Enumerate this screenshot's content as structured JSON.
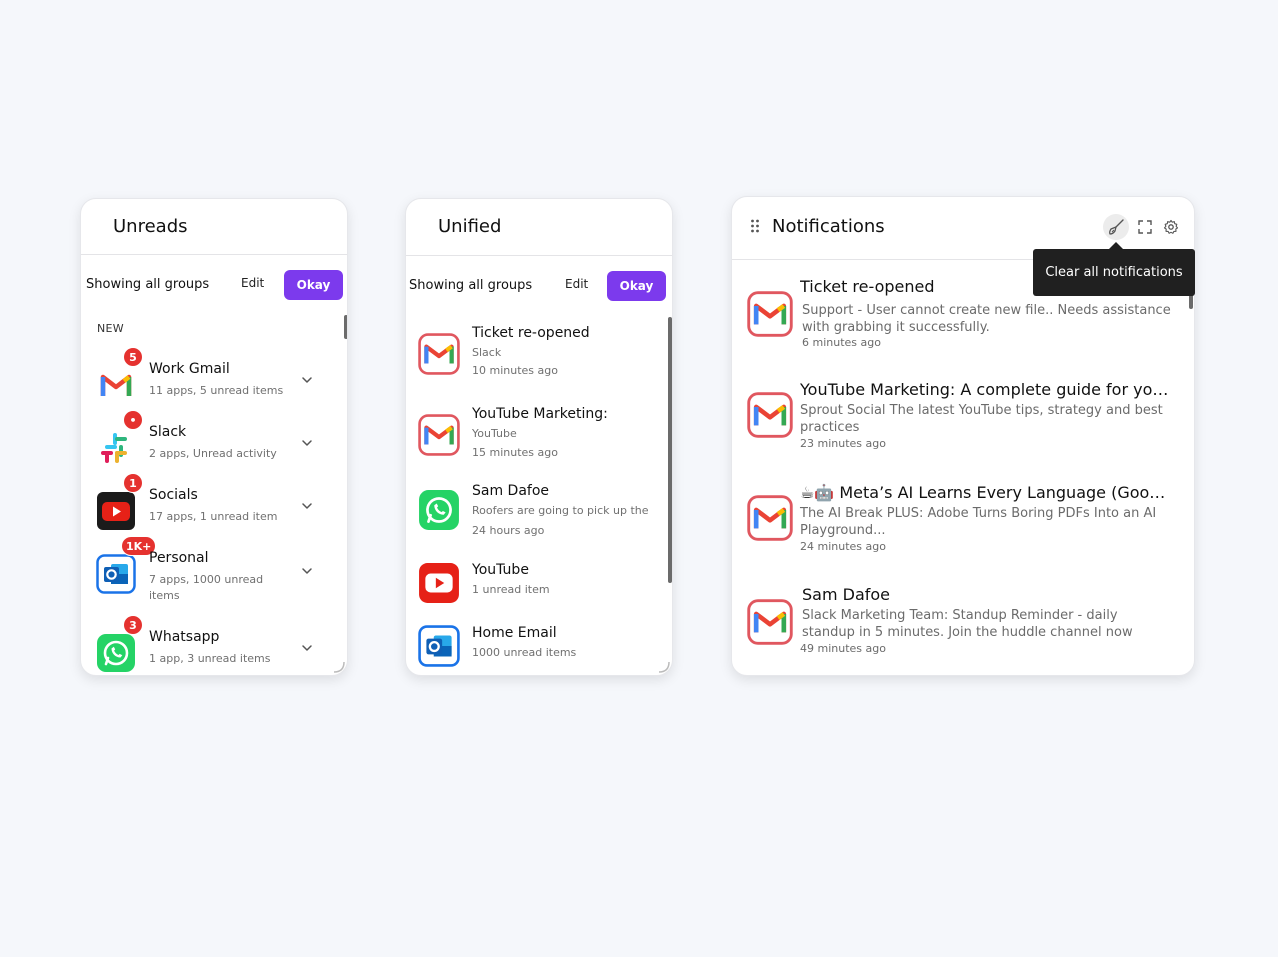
{
  "unreads": {
    "title": "Unreads",
    "showing": "Showing all groups",
    "edit_label": "Edit",
    "okay_label": "Okay",
    "section": "NEW",
    "groups": [
      {
        "name": "Work Gmail",
        "sub": "11 apps, 5 unread items",
        "badge": "5",
        "icon": "gmail-icon"
      },
      {
        "name": "Slack",
        "sub": "2 apps, Unread activity",
        "badge": "•",
        "icon": "slack-icon"
      },
      {
        "name": "Socials",
        "sub": "17 apps, 1 unread item",
        "badge": "1",
        "icon": "youtube-icon"
      },
      {
        "name": "Personal",
        "sub": "7 apps, 1000 unread items",
        "badge": "1K+",
        "icon": "outlook-icon"
      },
      {
        "name": "Whatsapp",
        "sub": "1 app, 3 unread items",
        "badge": "3",
        "icon": "whatsapp-icon"
      }
    ]
  },
  "unified": {
    "title": "Unified",
    "showing": "Showing all groups",
    "edit_label": "Edit",
    "okay_label": "Okay",
    "items": [
      {
        "title": "Ticket re-opened",
        "sub": "Slack",
        "time": "10 minutes ago",
        "icon": "gmail-icon"
      },
      {
        "title": "YouTube Marketing:",
        "sub": "YouTube",
        "time": "15 minutes ago",
        "icon": "gmail-icon"
      },
      {
        "title": "Sam Dafoe",
        "sub": "Roofers are going to pick up the",
        "time": "24 hours ago",
        "icon": "whatsapp-icon"
      },
      {
        "title": "YouTube",
        "sub": "1 unread item",
        "time": "",
        "icon": "youtube-icon"
      },
      {
        "title": "Home Email",
        "sub": "1000 unread items",
        "time": "",
        "icon": "outlook-icon"
      }
    ]
  },
  "notifications": {
    "title": "Notifications",
    "tooltip": "Clear all notifications",
    "items": [
      {
        "title": "Ticket re-opened",
        "desc": "Support - User cannot create new file.. Needs assistance with grabbing it successfully.",
        "time": "6 minutes ago"
      },
      {
        "title": "YouTube Marketing: A complete guide for your b...",
        "desc": "Sprout Social The latest YouTube tips, strategy and best practices",
        "time": "23 minutes ago"
      },
      {
        "title": "☕🤖 Meta’s AI Learns Every Language (Goodby...",
        "desc": "The AI Break PLUS: Adobe Turns Boring PDFs Into an AI Playground...",
        "time": "24 minutes ago"
      },
      {
        "title": "Sam Dafoe",
        "desc": "Slack Marketing Team: Standup Reminder - daily standup in 5 minutes. Join the huddle channel now",
        "time": "49 minutes ago"
      }
    ]
  },
  "colors": {
    "accent": "#7c3aed",
    "badge": "#e5322f",
    "tooltip_bg": "#202020"
  }
}
